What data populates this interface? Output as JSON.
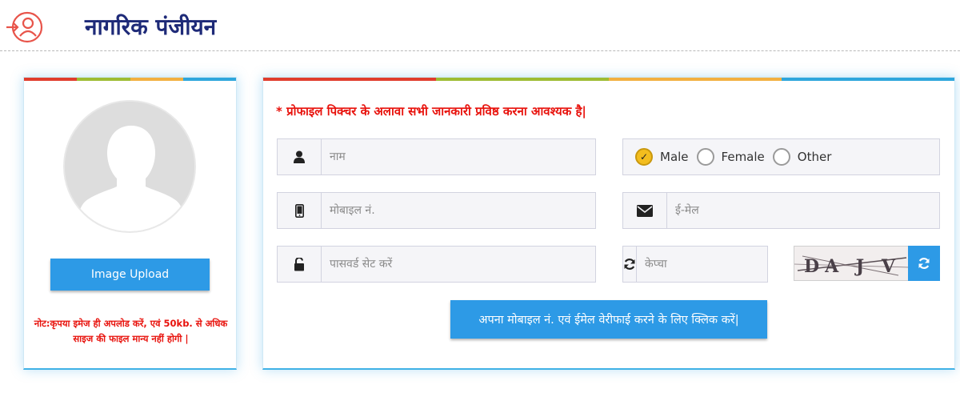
{
  "header": {
    "title": "नागरिक पंजीयन",
    "icon": "user-login-icon",
    "icon_color": "#e8544a",
    "title_color": "#1e2a78"
  },
  "profile": {
    "avatar_icon": "user-silhouette-icon",
    "upload_label": "Image Upload",
    "note": "नोट:कृपया इमेज ही अपलोड करें, एवं 50kb. से अधिक साइज की फाइल मान्य नहीं होगी |"
  },
  "form": {
    "required_note": "* प्रोफाइल पिक्चर के अलावा सभी जानकारी प्रविष्ठ करना आवश्यक है|",
    "name_placeholder": "नाम",
    "mobile_placeholder": "मोबाइल नं.",
    "email_placeholder": "ई-मेल",
    "password_placeholder": "पासवर्ड सेट करें",
    "captcha_placeholder": "केप्चा",
    "captcha_text": "DA J V U",
    "gender": {
      "options": [
        "Male",
        "Female",
        "Other"
      ],
      "selected": "Male"
    },
    "verify_label": "अपना मोबाइल नं. एवं ईमेल वेरीफाई करने के लिए क्लिक करें|"
  },
  "colors": {
    "accent": "#2d9ae6",
    "required_text": "#e8120c",
    "radio_checked": "#f3bd1e",
    "bar": [
      "#e03d2d",
      "#9ebc33",
      "#f2b041",
      "#2ea6dc"
    ]
  }
}
